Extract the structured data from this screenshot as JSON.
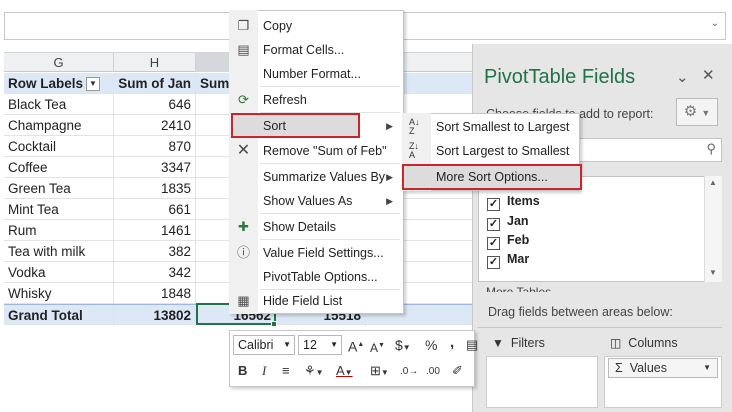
{
  "grid": {
    "columns": [
      "G",
      "H"
    ],
    "header": {
      "row_labels": "Row Labels",
      "sum_jan": "Sum of Jan",
      "sum_feb_partial": "Sum"
    },
    "rows": [
      {
        "label": "Black Tea",
        "jan": "646"
      },
      {
        "label": "Champagne",
        "jan": "2410"
      },
      {
        "label": "Cocktail",
        "jan": "870"
      },
      {
        "label": "Coffee",
        "jan": "3347"
      },
      {
        "label": "Green Tea",
        "jan": "1835"
      },
      {
        "label": "Mint Tea",
        "jan": "661"
      },
      {
        "label": "Rum",
        "jan": "1461"
      },
      {
        "label": "Tea with milk",
        "jan": "382"
      },
      {
        "label": "Vodka",
        "jan": "342"
      },
      {
        "label": "Whisky",
        "jan": "1848"
      }
    ],
    "total": {
      "label": "Grand Total",
      "jan": "13802",
      "feb": "16562",
      "mar": "15518"
    }
  },
  "context_menu": {
    "items": [
      {
        "label": "Copy",
        "icon": "copy-icon"
      },
      {
        "label": "Format Cells...",
        "icon": "format-cells-icon"
      },
      {
        "label": "Number Format...",
        "icon": ""
      },
      {
        "label": "Refresh",
        "icon": "refresh-icon"
      },
      {
        "label": "Sort",
        "icon": "",
        "submenu": true
      },
      {
        "label": "Remove \"Sum of Feb\"",
        "icon": "remove-icon"
      },
      {
        "label": "Summarize Values By",
        "icon": "",
        "submenu": true
      },
      {
        "label": "Show Values As",
        "icon": "",
        "submenu": true
      },
      {
        "label": "Show Details",
        "icon": "show-details-icon"
      },
      {
        "label": "Value Field Settings...",
        "icon": "field-settings-icon"
      },
      {
        "label": "PivotTable Options...",
        "icon": ""
      },
      {
        "label": "Hide Field List",
        "icon": "field-list-icon"
      }
    ]
  },
  "sort_submenu": {
    "items": [
      {
        "label": "Sort Smallest to Largest",
        "icon": "sort-ascending-icon"
      },
      {
        "label": "Sort Largest to Smallest",
        "icon": "sort-descending-icon"
      },
      {
        "label": "More Sort Options...",
        "icon": ""
      }
    ]
  },
  "mini_toolbar": {
    "font": "Calibri",
    "size": "12",
    "buttons": [
      "A",
      "A",
      "$",
      "%",
      ",",
      "B",
      "I"
    ]
  },
  "pivot_pane": {
    "title": "PivotTable Fields",
    "choose_label": "Choose fields to add to report:",
    "fields": [
      {
        "label": "Items",
        "checked": true
      },
      {
        "label": "Jan",
        "checked": true
      },
      {
        "label": "Feb",
        "checked": true
      },
      {
        "label": "Mar",
        "checked": true
      }
    ],
    "more_tables": "More Tables...",
    "drag_label": "Drag fields between areas below:",
    "filters_label": "Filters",
    "columns_label": "Columns",
    "values_chip": "Values"
  },
  "colors": {
    "accent": "#217346",
    "highlight": "#c8252c",
    "pivot_header": "#dde8f6"
  }
}
